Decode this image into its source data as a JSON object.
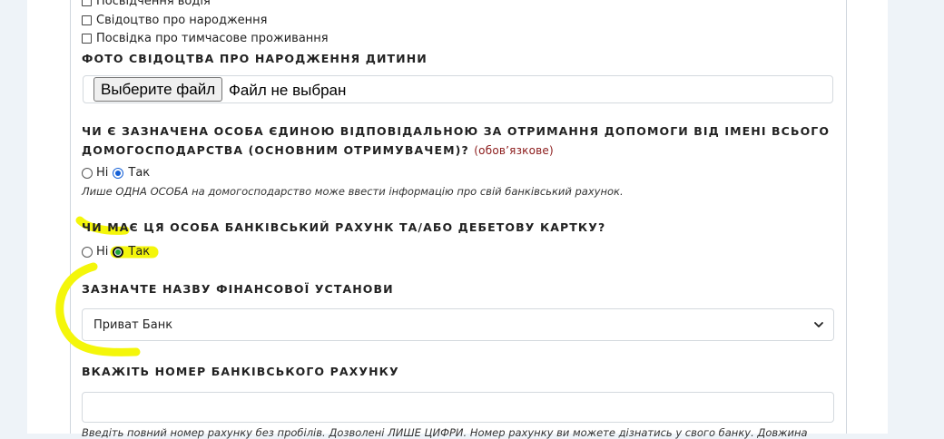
{
  "document_types": [
    {
      "label": "Посвідчення водія",
      "checked": false
    },
    {
      "label": "Свідоцтво про народження",
      "checked": false
    },
    {
      "label": "Посвідка про тимчасове проживання",
      "checked": false
    }
  ],
  "photo_section": {
    "label": "ФОТО СВІДОЦТВА ПРО НАРОДЖЕННЯ ДИТИНИ",
    "button_label": "Выберите файл",
    "no_file_text": "Файл не выбран"
  },
  "main_recipient": {
    "question": "ЧИ Є ЗАЗНАЧЕНА ОСОБА ЄДИНОЮ ВІДПОВІДАЛЬНОЮ ЗА ОТРИМАННЯ ДОПОМОГИ ВІД ІМЕНІ ВСЬОГО ДОМОГОСПОДАРСТВА (ОСНОВНИМ ОТРИМУВАЧЕМ)?",
    "required_text": "(обов’язкове)",
    "options": [
      {
        "label": "Ні",
        "selected": false
      },
      {
        "label": "Так",
        "selected": true
      }
    ],
    "hint": "Лише ОДНА ОСОБА на домогосподарство може ввести інформацію про свій банківський рахунок."
  },
  "bank_account": {
    "question": "ЧИ МАЄ ЦЯ ОСОБА БАНКІВСЬКИЙ РАХУНК ТА/АБО ДЕБЕТОВУ КАРТКУ?",
    "options": [
      {
        "label": "Ні",
        "selected": false
      },
      {
        "label": "Так",
        "selected": true
      }
    ]
  },
  "institution": {
    "label": "ЗАЗНАЧТЕ НАЗВУ ФІНАНСОВОЇ УСТАНОВИ",
    "selected_value": "Приват Банк"
  },
  "account_number": {
    "label": "ВКАЖІТЬ НОМЕР БАНКІВСЬКОГО РАХУНКУ",
    "value": "",
    "hint": "Введіть повний номер рахунку без пробілів. Дозволені ЛИШЕ ЦИФРИ. Номер рахунку ви можете дізнатись у свого банку. Довжина"
  },
  "colors": {
    "highlighter": "#f4f60a",
    "radio_selected": "#1560d6",
    "required": "#8b1a1a"
  }
}
